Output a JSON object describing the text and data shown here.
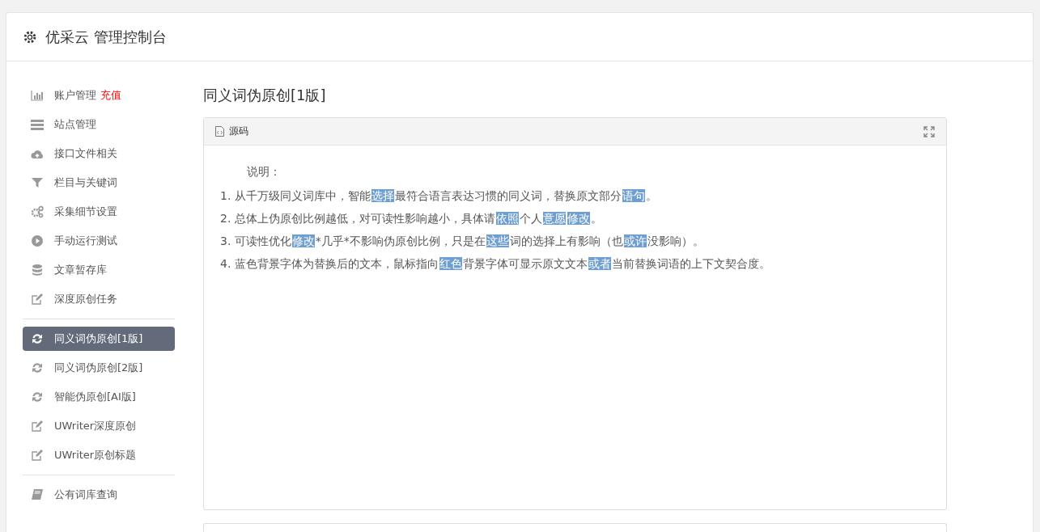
{
  "header": {
    "title": "优采云 管理控制台"
  },
  "sidebar": {
    "groups": [
      {
        "items": [
          {
            "label": "账户管理",
            "badge": "充值",
            "selected": false
          },
          {
            "label": "站点管理",
            "selected": false
          },
          {
            "label": "接口文件相关",
            "selected": false
          },
          {
            "label": "栏目与关键词",
            "selected": false
          },
          {
            "label": "采集细节设置",
            "selected": false
          },
          {
            "label": "手动运行测试",
            "selected": false
          },
          {
            "label": "文章暂存库",
            "selected": false
          },
          {
            "label": "深度原创任务",
            "selected": false
          }
        ]
      },
      {
        "items": [
          {
            "label": "同义词伪原创[1版]",
            "selected": true
          },
          {
            "label": "同义词伪原创[2版]",
            "selected": false
          },
          {
            "label": "智能伪原创[AI版]",
            "selected": false
          },
          {
            "label": "UWriter深度原创",
            "selected": false
          },
          {
            "label": "UWriter原创标题",
            "selected": false
          }
        ]
      },
      {
        "items": [
          {
            "label": "公有词库查询",
            "selected": false
          }
        ]
      }
    ]
  },
  "main": {
    "title": "同义词伪原创[1版]",
    "panel": {
      "tab": "源码",
      "intro": "说明：",
      "lines": [
        {
          "number": "1.",
          "parts": [
            {
              "text": "从千万级同义词库中，智能",
              "replaced": false
            },
            {
              "text": "选择",
              "replaced": true
            },
            {
              "text": "最符合语言表达习惯的同义词，替换原文部分",
              "replaced": false
            },
            {
              "text": "语句",
              "replaced": true
            },
            {
              "text": "。",
              "replaced": false
            }
          ]
        },
        {
          "number": "2.",
          "parts": [
            {
              "text": "总体上伪原创比例越低，对可读性影响越小，具体请",
              "replaced": false
            },
            {
              "text": "依照",
              "replaced": true
            },
            {
              "text": "个人",
              "replaced": false
            },
            {
              "text": "意愿",
              "replaced": true
            },
            {
              "text": "修改",
              "replaced": true
            },
            {
              "text": "。",
              "replaced": false
            }
          ]
        },
        {
          "number": "3.",
          "parts": [
            {
              "text": "可读性优化",
              "replaced": false
            },
            {
              "text": "修改",
              "replaced": true
            },
            {
              "text": "*几乎*不影响伪原创比例，只是在",
              "replaced": false
            },
            {
              "text": "这些",
              "replaced": true
            },
            {
              "text": "词的选择上有影响（也",
              "replaced": false
            },
            {
              "text": "或许",
              "replaced": true
            },
            {
              "text": "没影响）。",
              "replaced": false
            }
          ]
        },
        {
          "number": "4.",
          "parts": [
            {
              "text": "蓝色背景字体为替换后的文本，鼠标指向",
              "replaced": false
            },
            {
              "text": "红色",
              "replaced": true
            },
            {
              "text": "背景字体可显示原文文本",
              "replaced": false
            },
            {
              "text": "或者",
              "replaced": true
            },
            {
              "text": "当前替换词语的上下文契合度。",
              "replaced": false
            }
          ]
        }
      ]
    }
  }
}
